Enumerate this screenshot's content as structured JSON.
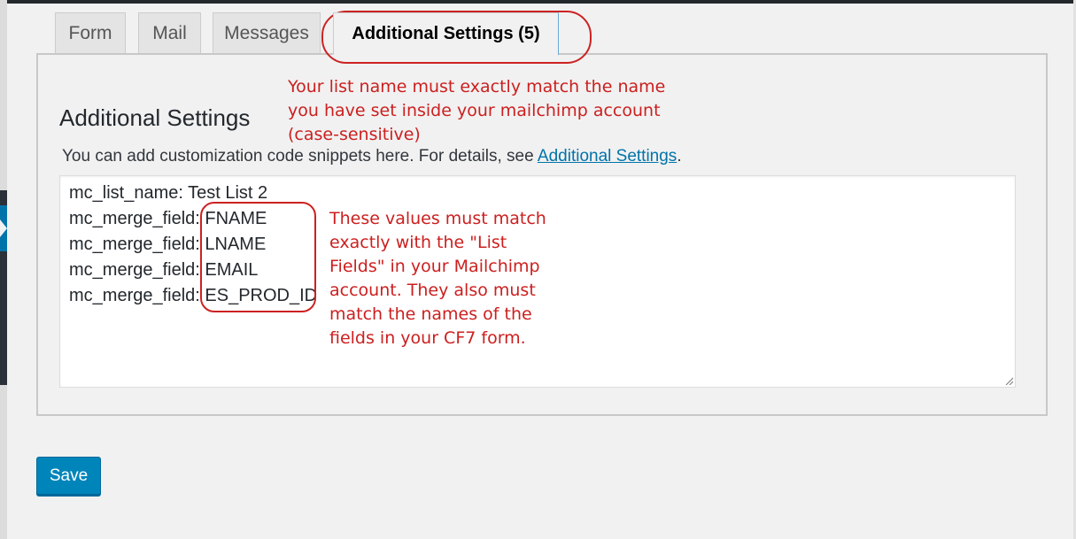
{
  "tabs": [
    {
      "label": "Form"
    },
    {
      "label": "Mail"
    },
    {
      "label": "Messages"
    },
    {
      "label": "Additional Settings (5)",
      "active": true
    }
  ],
  "section": {
    "heading": "Additional Settings",
    "description_prefix": "You can add customization code snippets here. For details, see ",
    "description_link": "Additional Settings",
    "description_suffix": "."
  },
  "editor": {
    "lines": [
      "mc_list_name: Test List 2",
      "mc_merge_field: FNAME",
      "mc_merge_field: LNAME",
      "mc_merge_field: EMAIL",
      "mc_merge_field: ES_PROD_ID"
    ]
  },
  "save_label": "Save",
  "annotations": {
    "list_name_note": [
      "Your list name must exactly match the name",
      "you have set inside your mailchimp account",
      "(case-sensitive)"
    ],
    "merge_fields_note": [
      "These values must match",
      "exactly with the \"List",
      "Fields\" in your Mailchimp",
      "account. They also must",
      "match the names of the",
      "fields in your CF7 form."
    ]
  },
  "colors": {
    "annotation_red": "#cc1f1f",
    "primary_button": "#0085ba",
    "link": "#0073aa"
  }
}
